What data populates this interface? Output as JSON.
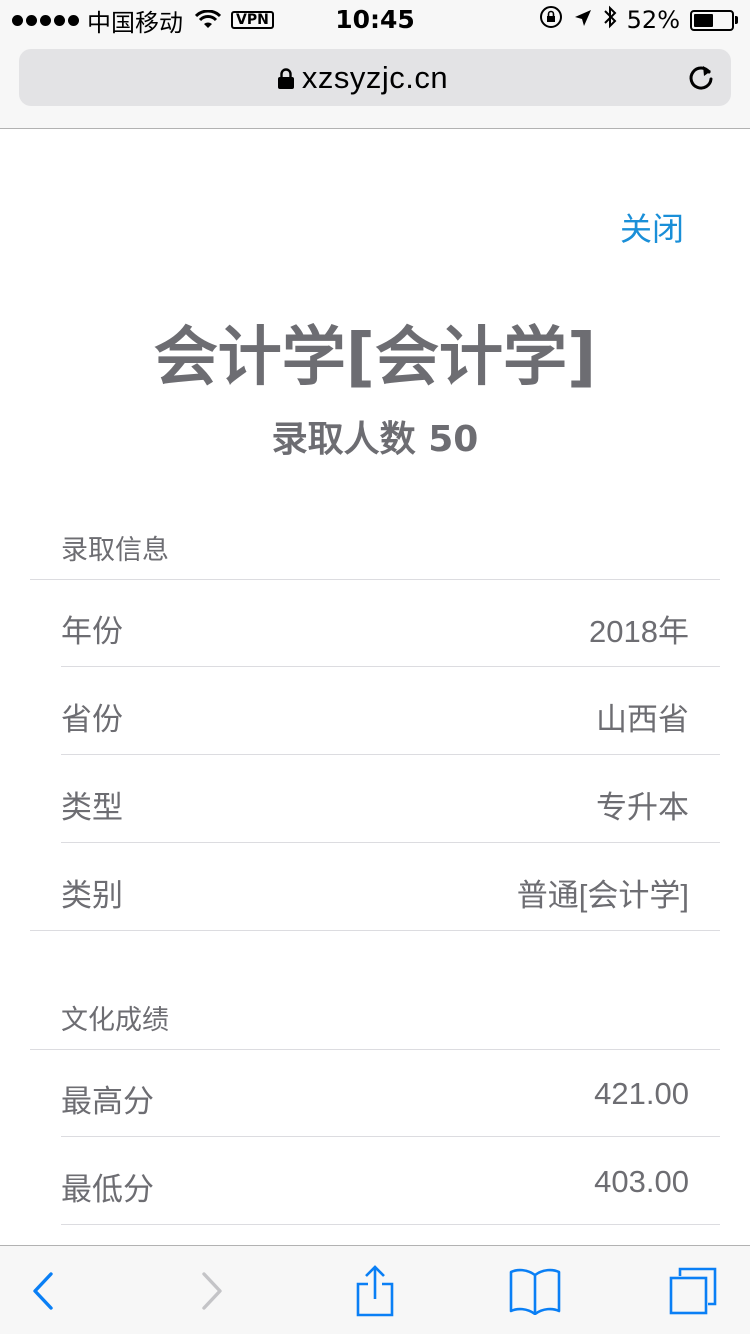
{
  "status_bar": {
    "carrier": "中国移动",
    "vpn": "VPN",
    "time": "10:45",
    "battery_percent": "52%",
    "battery_level": 0.52
  },
  "browser": {
    "url": "xzsyzjc.cn"
  },
  "modal": {
    "close_label": "关闭",
    "title": "会计学[会计学]",
    "admit_count": "录取人数 50",
    "sections": {
      "admission": {
        "header": "录取信息",
        "rows": [
          {
            "label": "年份",
            "value": "2018年"
          },
          {
            "label": "省份",
            "value": "山西省"
          },
          {
            "label": "类型",
            "value": "专升本"
          },
          {
            "label": "类别",
            "value": "普通[会计学]"
          }
        ]
      },
      "scores": {
        "header": "文化成绩",
        "rows": [
          {
            "label": "最高分",
            "value": "421.00"
          },
          {
            "label": "最低分",
            "value": "403.00"
          }
        ]
      }
    }
  },
  "icons": {
    "signal": "signal-dots-icon",
    "wifi": "wifi-icon",
    "orientation_lock": "orientation-lock-icon",
    "location": "location-arrow-icon",
    "bluetooth": "bluetooth-icon",
    "battery": "battery-icon",
    "lock": "lock-icon",
    "reload": "reload-icon",
    "back": "back-chevron-icon",
    "forward": "forward-chevron-icon",
    "share": "share-icon",
    "bookmarks": "bookmarks-icon",
    "tabs": "tabs-icon"
  },
  "colors": {
    "accent": "#1a8fd8",
    "text": "#6d6d72",
    "toolbar_blue": "#0a7ff5",
    "disabled": "#c4c4c7"
  }
}
